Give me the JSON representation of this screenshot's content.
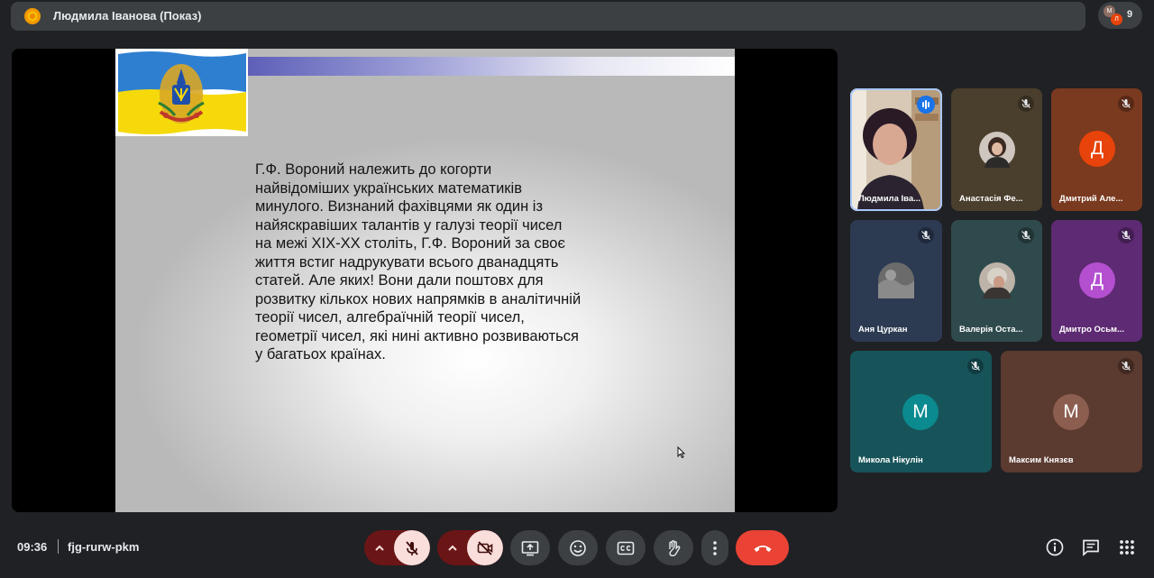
{
  "header": {
    "presenter_title": "Людмила Іванова (Показ)",
    "people_count": "9",
    "mini_avatars": [
      "М",
      "Л"
    ]
  },
  "slide": {
    "text": "Г.Ф. Вороний належить до когорти\nнайвідоміших українських математиків\nминулого. Визнаний фахівцями як один із\nнайяскравіших талантів у галузі теорії чисел\nна межі XIX-XX століть, Г.Ф. Вороний за своє\nжиття встиг надрукувати всього дванадцять\nстатей. Але яких! Вони дали поштовх для\nрозвитку кількох нових напрямків в аналітичній\nтеорії чисел, алгебраїчній теорії чисел,\nгеометрії чисел, які нині активно розвиваються\nу багатьох країнах."
  },
  "participants": [
    {
      "name": "Людмила Іва...",
      "type": "video",
      "muted": false,
      "speaking": true
    },
    {
      "name": "Анастасія Фе...",
      "type": "photo",
      "muted": true
    },
    {
      "name": "Дмитрий Але...",
      "initial": "Д",
      "avatar_color": "#e8430a",
      "tile_color": "#7a3a1f",
      "muted": true
    },
    {
      "name": "Аня Цуркан",
      "type": "photo",
      "muted": true
    },
    {
      "name": "Валерія Оста...",
      "type": "photo",
      "muted": true
    },
    {
      "name": "Дмитро Осьм...",
      "initial": "Д",
      "avatar_color": "#b44fd0",
      "tile_color": "#5e2a73",
      "muted": true
    },
    {
      "name": "Микола Нікулін",
      "initial": "M",
      "avatar_color": "#0b8a8f",
      "tile_color": "#17545a",
      "muted": true
    },
    {
      "name": "Максим Князєв",
      "initial": "M",
      "avatar_color": "#8c5e50",
      "tile_color": "#5b3a30",
      "muted": true
    }
  ],
  "footer": {
    "time": "09:36",
    "separator": "|",
    "meeting_code": "fjg-rurw-pkm"
  },
  "colors": {
    "background": "#202124",
    "control": "#3c4043",
    "danger": "#ea4335",
    "off_state": "#f9dedc"
  }
}
